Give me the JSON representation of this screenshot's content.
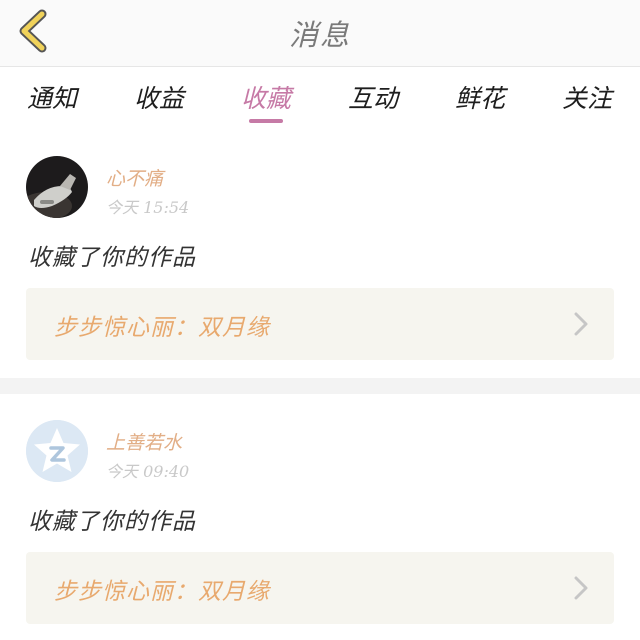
{
  "header": {
    "title": "消息"
  },
  "tabs": [
    {
      "label": "通知",
      "active": false
    },
    {
      "label": "收益",
      "active": false
    },
    {
      "label": "收藏",
      "active": true
    },
    {
      "label": "互动",
      "active": false
    },
    {
      "label": "鲜花",
      "active": false
    },
    {
      "label": "关注",
      "active": false
    }
  ],
  "messages": [
    {
      "user": "心不痛",
      "time": "今天 15:54",
      "content": "收藏了你的作品",
      "work_title": "步步惊心丽：双月缘",
      "avatar_icon": "photo-avatar-icon"
    },
    {
      "user": "上善若水",
      "time": "今天 09:40",
      "content": "收藏了你的作品",
      "work_title": "步步惊心丽：双月缘",
      "avatar_icon": "default-star-avatar-icon"
    }
  ],
  "colors": {
    "accent": "#c67aa6",
    "username": "#e2ae86",
    "work_title": "#e8a96e",
    "back_icon": "#f0d25a",
    "card_bg": "#f6f5ef"
  }
}
